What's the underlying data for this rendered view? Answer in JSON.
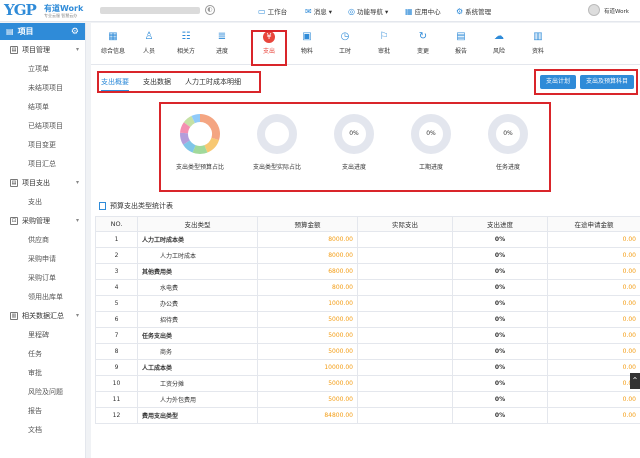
{
  "header": {
    "logo": "YGP",
    "brand": "有道Work",
    "slogan": "专业云服 智慧云办",
    "nav": [
      {
        "label": "工作台",
        "icon": "monitor-icon"
      },
      {
        "label": "消息 ▾",
        "icon": "message-icon"
      },
      {
        "label": "功能导航 ▾",
        "icon": "compass-icon"
      },
      {
        "label": "应用中心",
        "icon": "app-center-icon"
      },
      {
        "label": "系统管理",
        "icon": "settings-icon"
      }
    ],
    "user": "有道Work"
  },
  "sidebar": {
    "title": "项目",
    "groups": [
      {
        "label": "项目管理",
        "items": [
          "立项单",
          "未结项项目",
          "结项单",
          "已结项项目",
          "项目变更",
          "项目汇总"
        ]
      },
      {
        "label": "项目支出",
        "items": [
          "支出"
        ]
      },
      {
        "label": "采购管理",
        "items": [
          "供应商",
          "采购申请",
          "采购订单",
          "领用出库单"
        ]
      },
      {
        "label": "相关数据汇总",
        "items": [
          "里程碑",
          "任务",
          "审批",
          "风险及问题",
          "报告",
          "文档"
        ]
      }
    ]
  },
  "modules": [
    {
      "label": "综合信息",
      "icon": "grid-icon",
      "glyph": "▦"
    },
    {
      "label": "人员",
      "icon": "person-icon",
      "glyph": "♙"
    },
    {
      "label": "相关方",
      "icon": "stakeholder-icon",
      "glyph": "☷"
    },
    {
      "label": "进度",
      "icon": "progress-icon",
      "glyph": "≣"
    },
    {
      "label": "支出",
      "icon": "expense-icon",
      "glyph": "¥"
    },
    {
      "label": "物料",
      "icon": "box-icon",
      "glyph": "▣"
    },
    {
      "label": "工时",
      "icon": "clock-icon",
      "glyph": "◷"
    },
    {
      "label": "审批",
      "icon": "stamp-icon",
      "glyph": "⚐"
    },
    {
      "label": "变更",
      "icon": "refresh-icon",
      "glyph": "↻"
    },
    {
      "label": "报告",
      "icon": "report-icon",
      "glyph": "▤"
    },
    {
      "label": "风险",
      "icon": "cloud-risk-icon",
      "glyph": "☁"
    },
    {
      "label": "资料",
      "icon": "document-icon",
      "glyph": "▥"
    }
  ],
  "tabs": [
    "支出概要",
    "支出数据",
    "人力工时成本明细"
  ],
  "actions": [
    "支出计划",
    "支出及预算科目"
  ],
  "gauges": [
    {
      "label": "支出类型预算占比",
      "pct": ""
    },
    {
      "label": "支出类型实际占比",
      "pct": ""
    },
    {
      "label": "支出进度",
      "pct": "0%"
    },
    {
      "label": "工期进度",
      "pct": "0%"
    },
    {
      "label": "任务进度",
      "pct": "0%"
    }
  ],
  "pie_colors": [
    "#f4a582",
    "#f7c873",
    "#a1d99b",
    "#7fc5e8",
    "#b39ddb",
    "#f48fb1",
    "#c5e1a5",
    "#90caf9"
  ],
  "stat_title": "预算支出类型统计表",
  "table": {
    "headers": [
      "NO.",
      "支出类型",
      "预算金额",
      "实际支出",
      "支出进度",
      "在途申请金额"
    ],
    "rows": [
      {
        "no": "1",
        "type": "人力工时成本类",
        "budget": "8000.00",
        "actual": "",
        "progress": "0%",
        "pending": "0.00",
        "level": 0
      },
      {
        "no": "2",
        "type": "人力工时成本",
        "budget": "8000.00",
        "actual": "",
        "progress": "0%",
        "pending": "0.00",
        "level": 1
      },
      {
        "no": "3",
        "type": "其他费用类",
        "budget": "6800.00",
        "actual": "",
        "progress": "0%",
        "pending": "0.00",
        "level": 0
      },
      {
        "no": "4",
        "type": "水电费",
        "budget": "800.00",
        "actual": "",
        "progress": "0%",
        "pending": "0.00",
        "level": 1
      },
      {
        "no": "5",
        "type": "办公费",
        "budget": "1000.00",
        "actual": "",
        "progress": "0%",
        "pending": "0.00",
        "level": 1
      },
      {
        "no": "6",
        "type": "招待费",
        "budget": "5000.00",
        "actual": "",
        "progress": "0%",
        "pending": "0.00",
        "level": 1
      },
      {
        "no": "7",
        "type": "任务支出类",
        "budget": "5000.00",
        "actual": "",
        "progress": "0%",
        "pending": "0.00",
        "level": 0
      },
      {
        "no": "8",
        "type": "商务",
        "budget": "5000.00",
        "actual": "",
        "progress": "0%",
        "pending": "0.00",
        "level": 1
      },
      {
        "no": "9",
        "type": "人工成本类",
        "budget": "10000.00",
        "actual": "",
        "progress": "0%",
        "pending": "0.00",
        "level": 0
      },
      {
        "no": "10",
        "type": "工资分摊",
        "budget": "5000.00",
        "actual": "",
        "progress": "0%",
        "pending": "0.00",
        "level": 1
      },
      {
        "no": "11",
        "type": "人力外包费用",
        "budget": "5000.00",
        "actual": "",
        "progress": "0%",
        "pending": "0.00",
        "level": 1
      },
      {
        "no": "12",
        "type": "费用支出类型",
        "budget": "84800.00",
        "actual": "",
        "progress": "0%",
        "pending": "0.00",
        "level": 0
      }
    ]
  },
  "colors": {
    "primary": "#2f8bd8",
    "highlight": "#d9252a",
    "amount": "#f39c12",
    "active_module": "#e8453c"
  }
}
